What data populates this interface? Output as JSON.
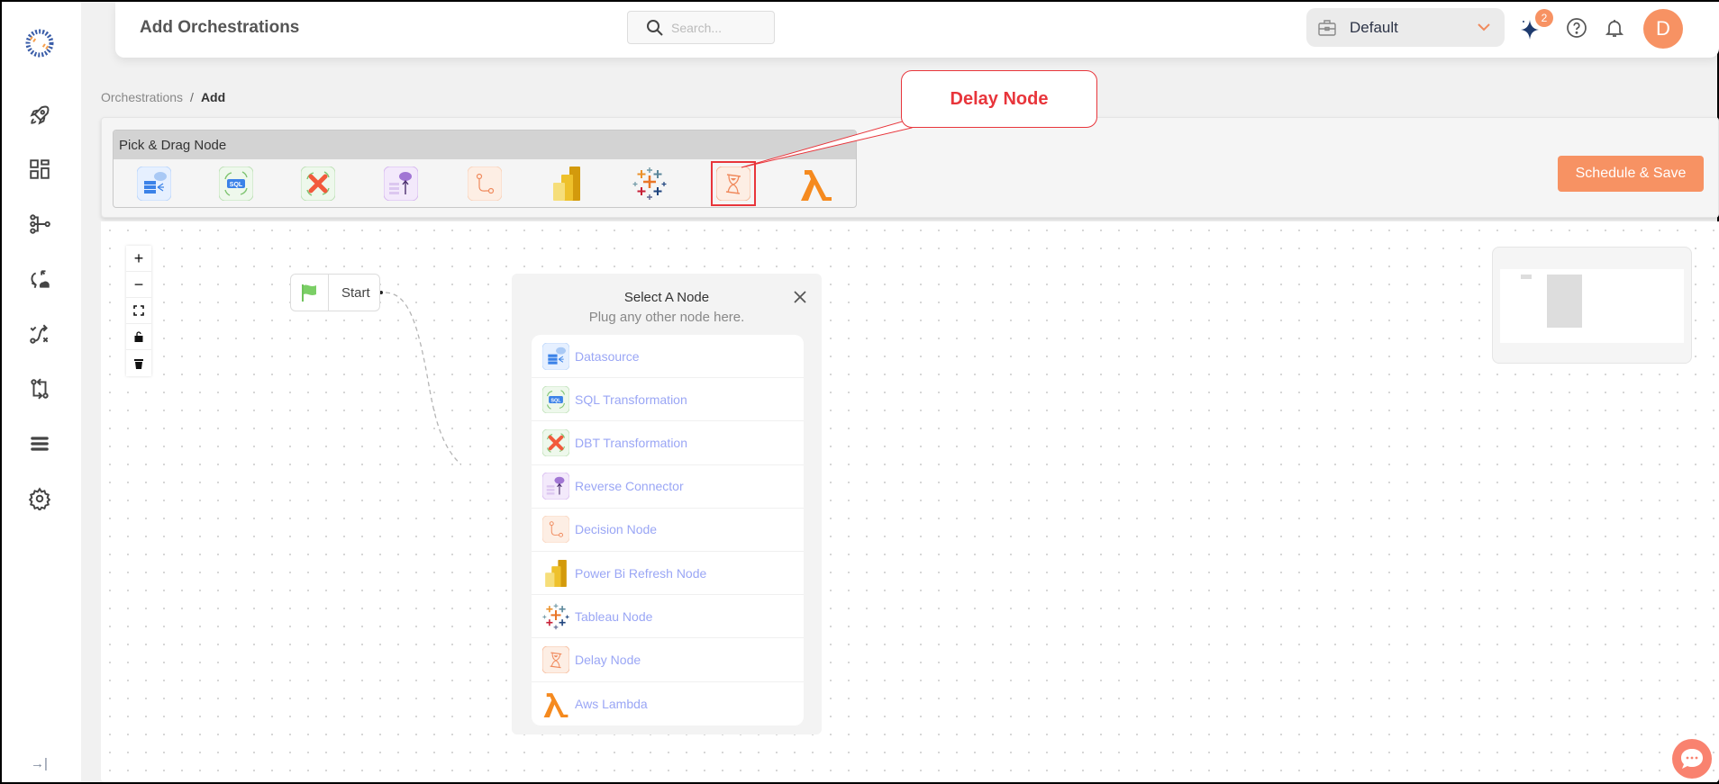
{
  "header": {
    "title": "Add Orchestrations",
    "search_placeholder": "Search...",
    "workspace": "Default",
    "notification_badge": "2",
    "avatar_initial": "D"
  },
  "sidebar": {
    "items": [
      {
        "icon": "rocket-icon"
      },
      {
        "icon": "dashboard-icon"
      },
      {
        "icon": "pipeline-icon"
      },
      {
        "icon": "sync-icon"
      },
      {
        "icon": "route-icon"
      },
      {
        "icon": "git-compare-icon"
      },
      {
        "icon": "list-icon"
      },
      {
        "icon": "gear-icon"
      }
    ],
    "collapse_icon": "→|"
  },
  "breadcrumb": {
    "parent": "Orchestrations",
    "separator": "/",
    "current": "Add"
  },
  "palette": {
    "title": "Pick & Drag Node",
    "items": [
      {
        "name": "Datasource",
        "icon": "datasource-icon"
      },
      {
        "name": "SQL Transformation",
        "icon": "sql-icon"
      },
      {
        "name": "DBT Transformation",
        "icon": "dbt-icon"
      },
      {
        "name": "Reverse Connector",
        "icon": "reverse-connector-icon"
      },
      {
        "name": "Decision Node",
        "icon": "decision-icon"
      },
      {
        "name": "Power Bi Refresh Node",
        "icon": "powerbi-icon"
      },
      {
        "name": "Tableau Node",
        "icon": "tableau-icon"
      },
      {
        "name": "Delay Node",
        "icon": "hourglass-icon",
        "highlighted": true
      },
      {
        "name": "Aws Lambda",
        "icon": "lambda-icon"
      }
    ]
  },
  "actions": {
    "schedule_save": "Schedule & Save"
  },
  "callout": {
    "text": "Delay Node"
  },
  "canvas": {
    "zoom_controls": [
      "+",
      "−",
      "fit",
      "lock",
      "delete"
    ],
    "start_node": "Start"
  },
  "node_panel": {
    "title": "Select A Node",
    "subtitle": "Plug any other node here.",
    "items": [
      "Datasource",
      "SQL Transformation",
      "DBT Transformation",
      "Reverse Connector",
      "Decision Node",
      "Power Bi Refresh Node",
      "Tableau Node",
      "Delay Node",
      "Aws Lambda"
    ]
  },
  "colors": {
    "accent": "#f79263",
    "callout": "#e8353b",
    "node_text": "#9aa6f5"
  }
}
